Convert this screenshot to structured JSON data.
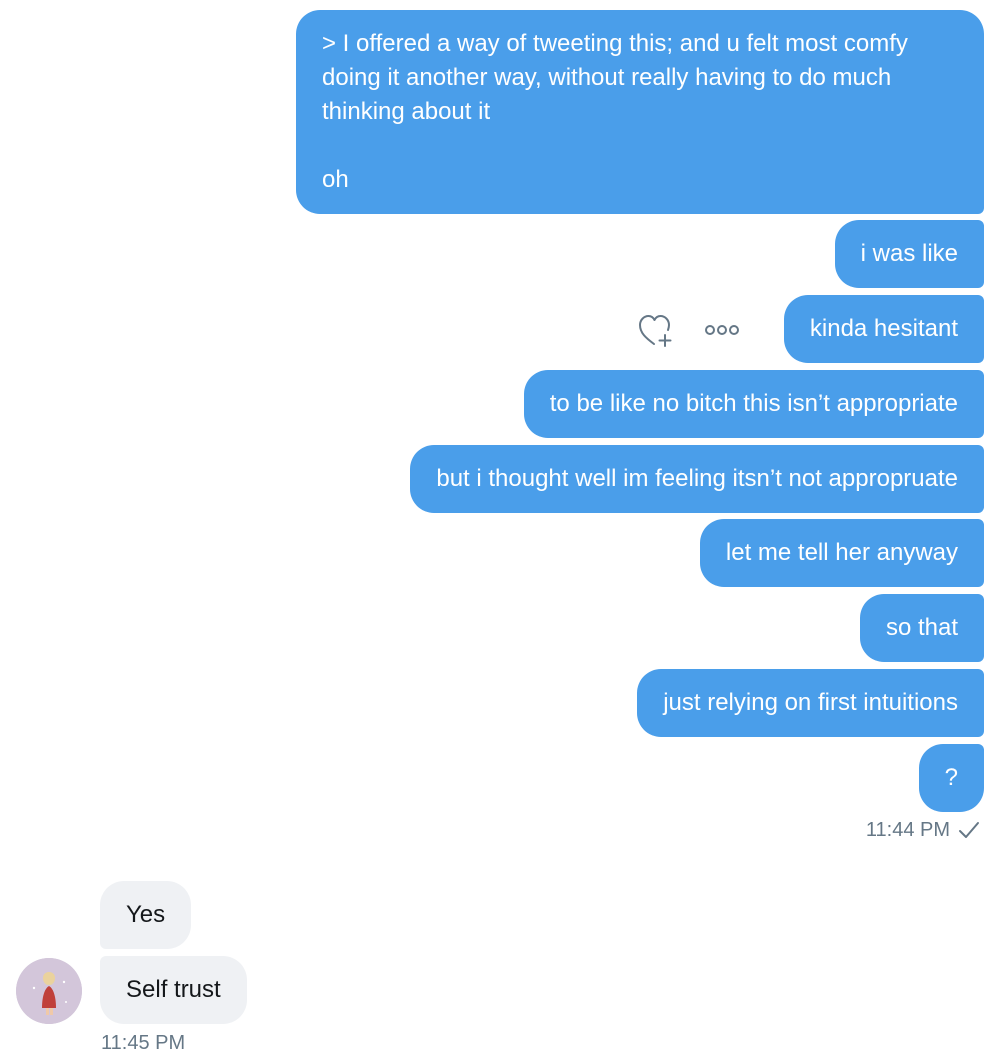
{
  "conversation": {
    "sent_messages": [
      {
        "lines": [
          "> I offered a way of tweeting this; and u felt most comfy doing it another way, without really having to do much thinking about it",
          "oh"
        ]
      },
      {
        "text": "i was like"
      },
      {
        "text": "kinda hesitant"
      },
      {
        "text": "to be like no bitch this isn’t appropriate"
      },
      {
        "text": "but i thought well im feeling itsn’t not appropruate"
      },
      {
        "text": "let me tell her anyway"
      },
      {
        "text": "so that"
      },
      {
        "text": "just relying on first intuitions"
      },
      {
        "text": "?"
      }
    ],
    "sent_timestamp": "11:44 PM",
    "read_receipt_icon": "checkmark-icon",
    "received_messages": [
      {
        "text": "Yes"
      },
      {
        "text": "Self trust"
      }
    ],
    "received_timestamp": "11:45 PM",
    "avatar_icon": "avatar"
  },
  "message_actions": {
    "react_icon": "heart-plus-icon",
    "more_icon": "more-dots-icon"
  },
  "colors": {
    "sent_bubble": "#4a9eea",
    "received_bubble": "#eff1f4",
    "timestamp": "#657786",
    "icon": "#657786"
  }
}
